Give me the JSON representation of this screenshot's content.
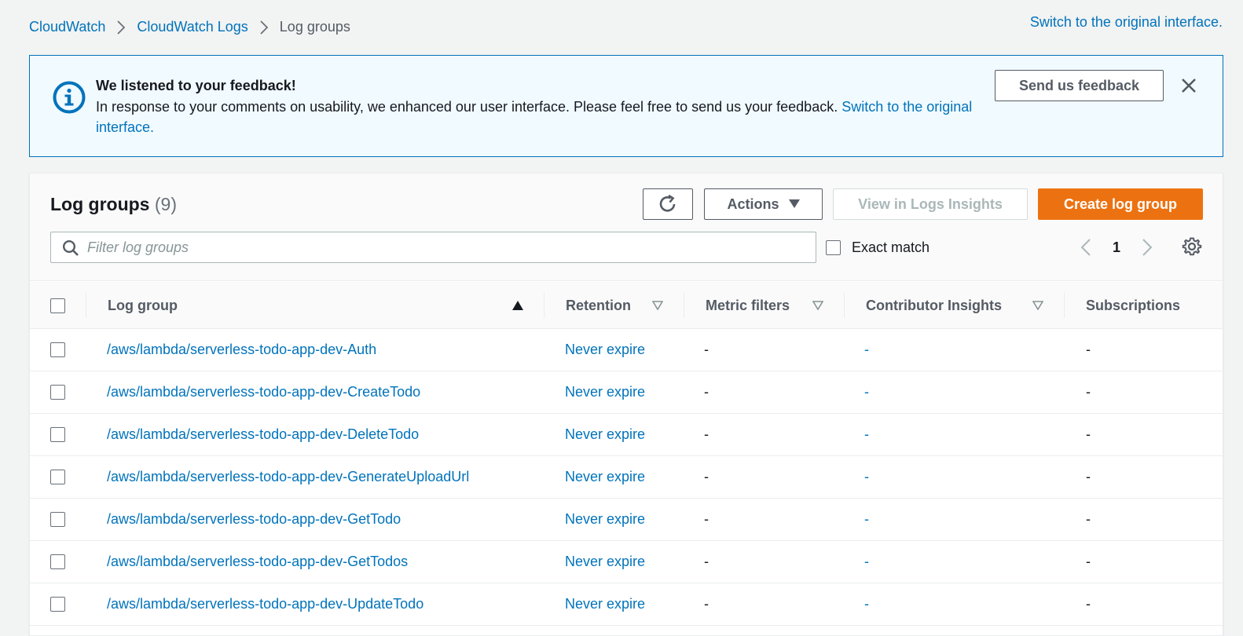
{
  "breadcrumb": [
    {
      "label": "CloudWatch"
    },
    {
      "label": "CloudWatch Logs"
    },
    {
      "label": "Log groups"
    }
  ],
  "switch_top": "Switch to the original interface.",
  "flash": {
    "title": "We listened to your feedback!",
    "body": "In response to your comments on usability, we enhanced our user interface. Please feel free to send us your feedback.",
    "link": "Switch to the original interface.",
    "feedback_button": "Send us feedback"
  },
  "panel": {
    "title": "Log groups",
    "count": "(9)",
    "actions_label": "Actions",
    "insights_label": "View in Logs Insights",
    "create_label": "Create log group",
    "filter_placeholder": "Filter log groups",
    "exact_match_label": "Exact match",
    "page": "1"
  },
  "columns": {
    "log_group": "Log group",
    "retention": "Retention",
    "metric_filters": "Metric filters",
    "contributor_insights": "Contributor Insights",
    "subscriptions": "Subscriptions"
  },
  "rows": [
    {
      "name": "/aws/lambda/serverless-todo-app-dev-Auth",
      "retention": "Never expire",
      "metric": "-",
      "insights": "-",
      "subs": "-"
    },
    {
      "name": "/aws/lambda/serverless-todo-app-dev-CreateTodo",
      "retention": "Never expire",
      "metric": "-",
      "insights": "-",
      "subs": "-"
    },
    {
      "name": "/aws/lambda/serverless-todo-app-dev-DeleteTodo",
      "retention": "Never expire",
      "metric": "-",
      "insights": "-",
      "subs": "-"
    },
    {
      "name": "/aws/lambda/serverless-todo-app-dev-GenerateUploadUrl",
      "retention": "Never expire",
      "metric": "-",
      "insights": "-",
      "subs": "-"
    },
    {
      "name": "/aws/lambda/serverless-todo-app-dev-GetTodo",
      "retention": "Never expire",
      "metric": "-",
      "insights": "-",
      "subs": "-"
    },
    {
      "name": "/aws/lambda/serverless-todo-app-dev-GetTodos",
      "retention": "Never expire",
      "metric": "-",
      "insights": "-",
      "subs": "-"
    },
    {
      "name": "/aws/lambda/serverless-todo-app-dev-UpdateTodo",
      "retention": "Never expire",
      "metric": "-",
      "insights": "-",
      "subs": "-"
    }
  ],
  "colors": {
    "link": "#0073bb",
    "primary_button": "#ec7211",
    "flash_background": "#f1faff"
  }
}
